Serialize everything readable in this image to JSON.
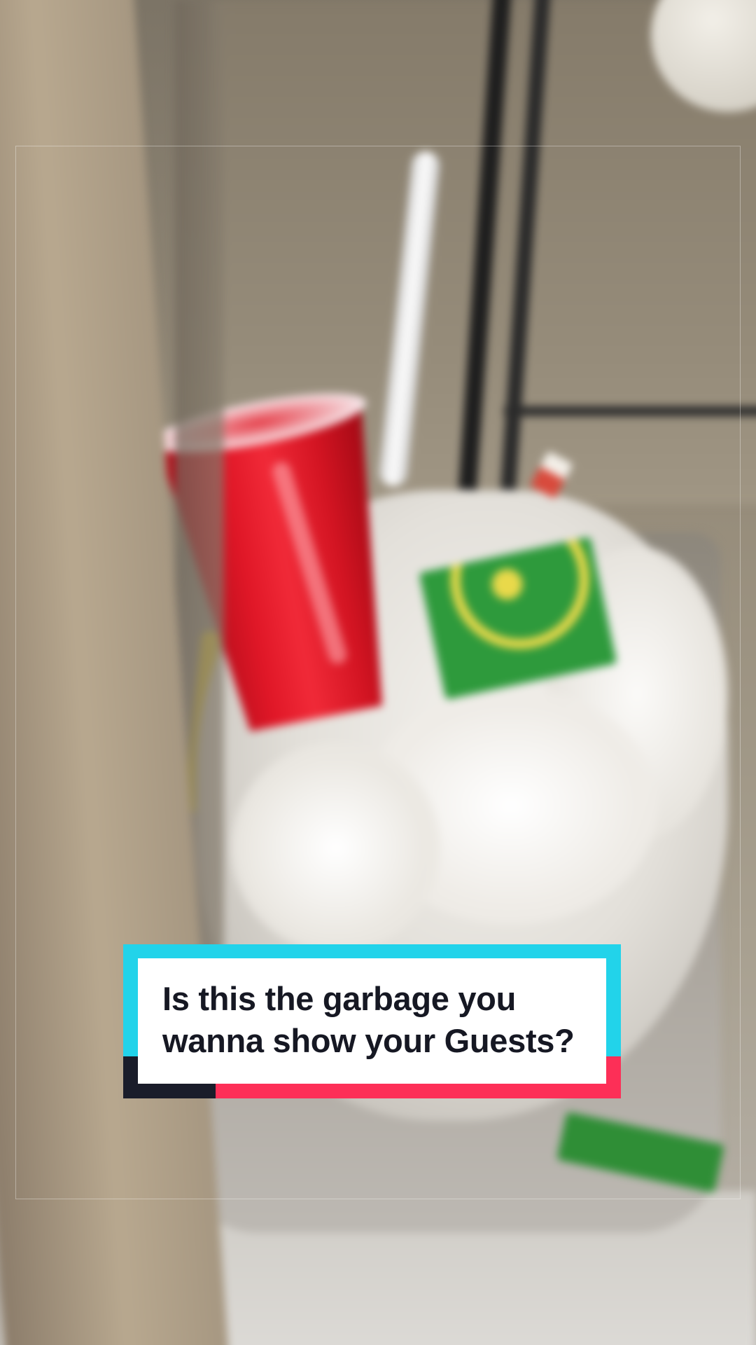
{
  "caption": {
    "line1": "Is this the garbage you",
    "line2": "wanna show your Guests?"
  },
  "colors": {
    "sticker_cyan": "#22d3ea",
    "sticker_pink": "#fd2f57",
    "sticker_dark": "#1a1d2a",
    "caption_text": "#161823",
    "cup_red": "#e01727",
    "box_green": "#2e9a3c",
    "box_yellow": "#e9d94a"
  }
}
